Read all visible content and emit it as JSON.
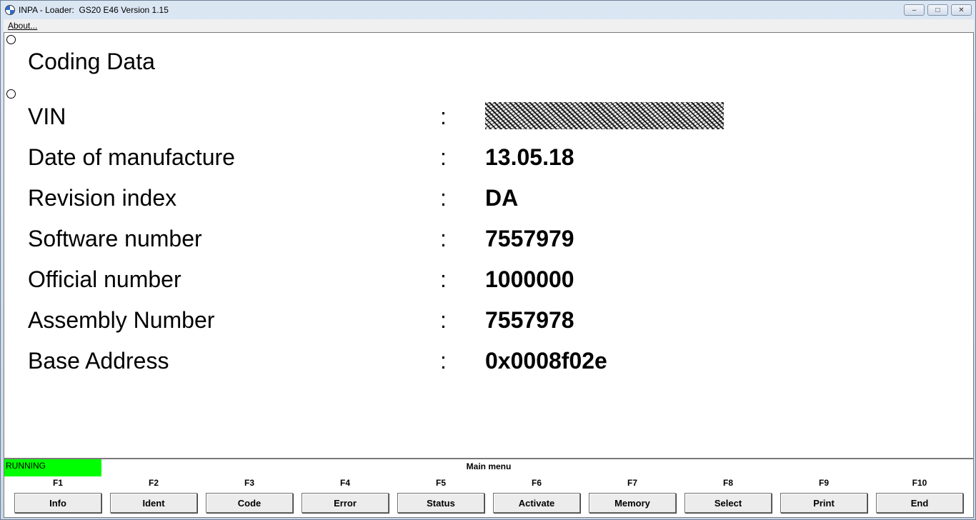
{
  "window": {
    "title": "INPA - Loader:  GS20 E46 Version 1.15",
    "app_icon": "bmw-logo-icon"
  },
  "menubar": {
    "items": [
      {
        "label": "About..."
      }
    ]
  },
  "content": {
    "heading": "Coding Data",
    "rows": [
      {
        "label": "VIN",
        "sep": ":",
        "value": ""
      },
      {
        "label": "Date of manufacture",
        "sep": ":",
        "value": "13.05.18"
      },
      {
        "label": "Revision index",
        "sep": ":",
        "value": "DA"
      },
      {
        "label": "Software number",
        "sep": ":",
        "value": "7557979"
      },
      {
        "label": "Official number",
        "sep": ":",
        "value": "1000000"
      },
      {
        "label": "Assembly Number",
        "sep": ":",
        "value": "7557978"
      },
      {
        "label": "Base Address",
        "sep": ":",
        "value": "0x0008f02e"
      }
    ]
  },
  "statusbar": {
    "status": "RUNNING",
    "status_color": "#00ff00",
    "menu_title": "Main menu"
  },
  "function_keys": [
    {
      "key": "F1",
      "label": "Info"
    },
    {
      "key": "F2",
      "label": "Ident"
    },
    {
      "key": "F3",
      "label": "Code"
    },
    {
      "key": "F4",
      "label": "Error"
    },
    {
      "key": "F5",
      "label": "Status"
    },
    {
      "key": "F6",
      "label": "Activate"
    },
    {
      "key": "F7",
      "label": "Memory"
    },
    {
      "key": "F8",
      "label": "Select"
    },
    {
      "key": "F9",
      "label": "Print"
    },
    {
      "key": "F10",
      "label": "End"
    }
  ]
}
